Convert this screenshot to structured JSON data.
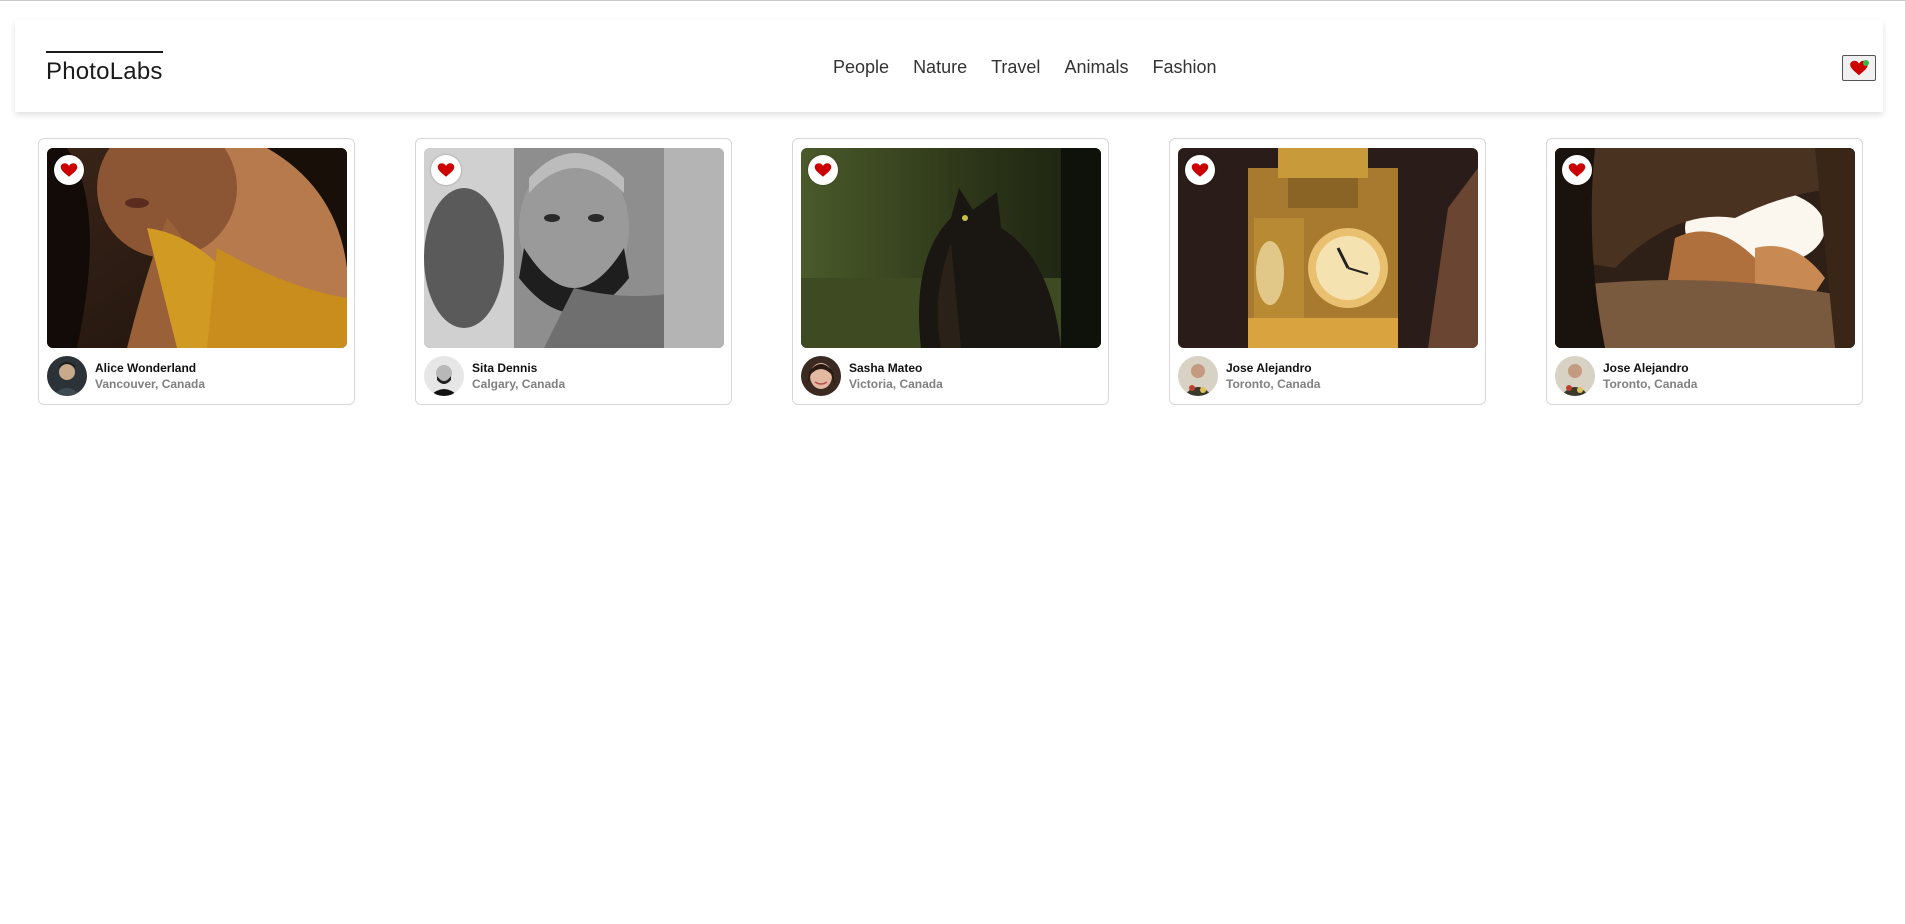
{
  "app": {
    "logo": "PhotoLabs",
    "accent_color": "#cc0000"
  },
  "nav": {
    "topics": [
      "People",
      "Nature",
      "Travel",
      "Animals",
      "Fashion"
    ],
    "fav_icon": "heart-icon",
    "fav_indicator_color": "#3ab54a"
  },
  "photos": [
    {
      "name": "Alice Wonderland",
      "location": "Vancouver, Canada",
      "subject": "woman-portrait"
    },
    {
      "name": "Sita Dennis",
      "location": "Calgary, Canada",
      "subject": "man-portrait"
    },
    {
      "name": "Sasha Mateo",
      "location": "Victoria, Canada",
      "subject": "cat"
    },
    {
      "name": "Jose Alejandro",
      "location": "Toronto, Canada",
      "subject": "clock-tower"
    },
    {
      "name": "Jose Alejandro",
      "location": "Toronto, Canada",
      "subject": "cave"
    }
  ]
}
